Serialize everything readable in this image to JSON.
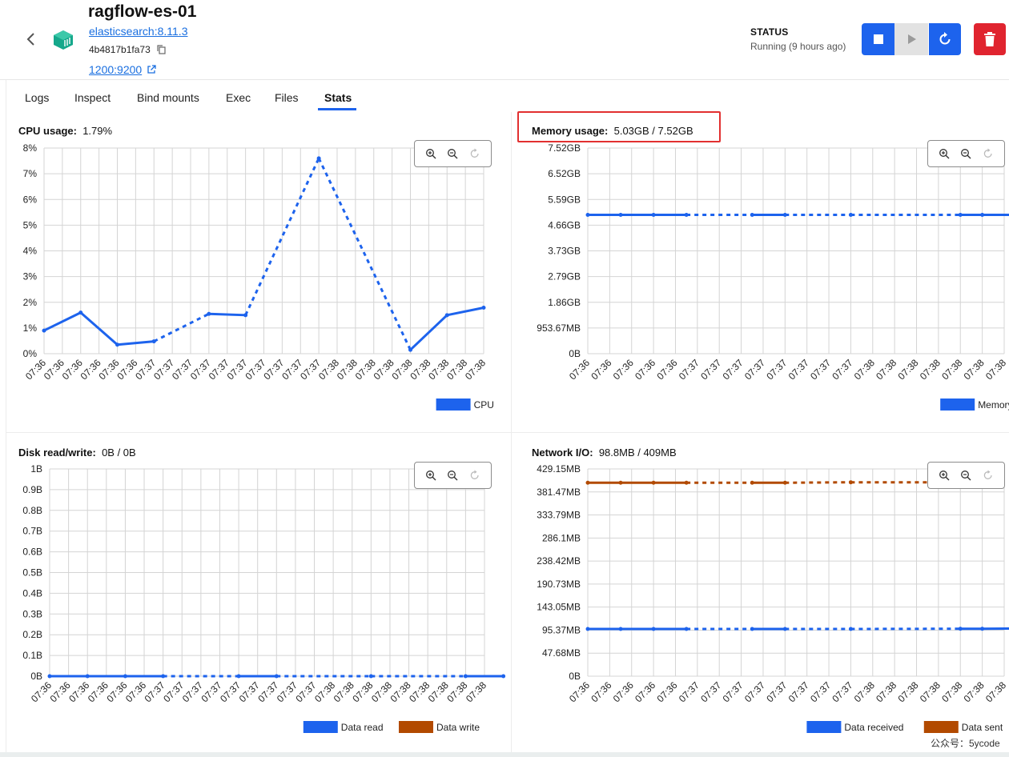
{
  "header": {
    "back_icon": "chevron-left-icon",
    "container_icon": "container-cube-icon",
    "name": "ragflow-es-01",
    "image": "elasticsearch:8.11.3",
    "container_id": "4b4817b1fa73",
    "port": "1200:9200",
    "status_label": "STATUS",
    "status_value": "Running (9 hours ago)",
    "accent_color": "#1d63ed",
    "danger_color": "#e0242f"
  },
  "tabs": [
    {
      "label": "Logs",
      "active": false
    },
    {
      "label": "Inspect",
      "active": false
    },
    {
      "label": "Bind mounts",
      "active": false
    },
    {
      "label": "Exec",
      "active": false
    },
    {
      "label": "Files",
      "active": false
    },
    {
      "label": "Stats",
      "active": true
    }
  ],
  "panels": {
    "cpu": {
      "title": "CPU usage:",
      "value": "1.79%"
    },
    "memory": {
      "title": "Memory usage:",
      "value": "5.03GB / 7.52GB"
    },
    "disk": {
      "title": "Disk read/write:",
      "value": "0B / 0B"
    },
    "network": {
      "title": "Network I/O:",
      "value": "98.8MB / 409MB"
    }
  },
  "watermark": "公众号：5ycode",
  "chart_data": [
    {
      "id": "cpu",
      "type": "line",
      "title": "CPU usage:",
      "x": [
        "07:36",
        "07:36",
        "07:36",
        "07:36",
        "07:36",
        "07:36",
        "07:37",
        "07:37",
        "07:37",
        "07:37",
        "07:37",
        "07:37",
        "07:37",
        "07:37",
        "07:37",
        "07:37",
        "07:38",
        "07:38",
        "07:38",
        "07:38",
        "07:38",
        "07:38",
        "07:38",
        "07:38",
        "07:38"
      ],
      "yticks": [
        "0%",
        "1%",
        "2%",
        "3%",
        "4%",
        "5%",
        "6%",
        "7%",
        "8%"
      ],
      "ylim": [
        0,
        8
      ],
      "grid": true,
      "legend_position": "bottom-right",
      "series": [
        {
          "name": "CPU",
          "color": "#1d63ed",
          "points": [
            [
              0,
              0.9
            ],
            [
              2,
              1.6
            ],
            [
              4,
              0.35
            ],
            [
              6,
              0.48
            ],
            [
              9,
              1.55
            ],
            [
              11,
              1.5
            ],
            [
              15,
              7.6
            ],
            [
              20,
              0.15
            ],
            [
              22,
              1.5
            ],
            [
              24,
              1.79
            ]
          ],
          "dashed_ranges": [
            [
              6,
              9
            ],
            [
              11,
              20
            ]
          ]
        }
      ]
    },
    {
      "id": "memory",
      "type": "line",
      "title": "Memory usage:",
      "x": [
        "07:36",
        "07:36",
        "07:36",
        "07:36",
        "07:36",
        "07:37",
        "07:37",
        "07:37",
        "07:37",
        "07:37",
        "07:37",
        "07:37",
        "07:37",
        "07:38",
        "07:38",
        "07:38",
        "07:38",
        "07:38",
        "07:38",
        "07:38"
      ],
      "yticks": [
        "0B",
        "953.67MB",
        "1.86GB",
        "2.79GB",
        "3.73GB",
        "4.66GB",
        "5.59GB",
        "6.52GB",
        "7.52GB"
      ],
      "ylim": [
        0,
        8
      ],
      "grid": true,
      "legend_position": "bottom-right",
      "series": [
        {
          "name": "Memory",
          "color": "#1d63ed",
          "points": [
            [
              0,
              5.4
            ],
            [
              1.5,
              5.4
            ],
            [
              3,
              5.4
            ],
            [
              4.5,
              5.4
            ],
            [
              7.5,
              5.4
            ],
            [
              9,
              5.4
            ],
            [
              12,
              5.4
            ],
            [
              17,
              5.4
            ],
            [
              18,
              5.4
            ],
            [
              19.5,
              5.4
            ]
          ],
          "dashed_ranges": [
            [
              4.5,
              7.5
            ],
            [
              9,
              17
            ]
          ]
        }
      ]
    },
    {
      "id": "disk",
      "type": "line",
      "title": "Disk read/write:",
      "x": [
        "07:36",
        "07:36",
        "07:36",
        "07:36",
        "07:36",
        "07:36",
        "07:37",
        "07:37",
        "07:37",
        "07:37",
        "07:37",
        "07:37",
        "07:37",
        "07:37",
        "07:37",
        "07:38",
        "07:38",
        "07:38",
        "07:38",
        "07:38",
        "07:38",
        "07:38",
        "07:38",
        "07:38"
      ],
      "yticks": [
        "0B",
        "0.1B",
        "0.2B",
        "0.3B",
        "0.4B",
        "0.5B",
        "0.6B",
        "0.7B",
        "0.8B",
        "0.9B",
        "1B"
      ],
      "ylim": [
        0,
        1
      ],
      "grid": true,
      "legend_position": "bottom-right",
      "series": [
        {
          "name": "Data read",
          "color": "#1d63ed",
          "points": [
            [
              0,
              0
            ],
            [
              2,
              0
            ],
            [
              4,
              0
            ],
            [
              6,
              0
            ],
            [
              10,
              0
            ],
            [
              12,
              0
            ],
            [
              17,
              0
            ],
            [
              22,
              0
            ],
            [
              24,
              0
            ]
          ],
          "dashed_ranges": [
            [
              6,
              10
            ],
            [
              12,
              22
            ]
          ]
        },
        {
          "name": "Data write",
          "color": "#b24a00",
          "points": [],
          "dashed_ranges": []
        }
      ]
    },
    {
      "id": "network",
      "type": "line",
      "title": "Network I/O:",
      "x": [
        "07:36",
        "07:36",
        "07:36",
        "07:36",
        "07:36",
        "07:37",
        "07:37",
        "07:37",
        "07:37",
        "07:37",
        "07:37",
        "07:37",
        "07:37",
        "07:38",
        "07:38",
        "07:38",
        "07:38",
        "07:38",
        "07:38",
        "07:38"
      ],
      "yticks": [
        "0B",
        "47.68MB",
        "95.37MB",
        "143.05MB",
        "190.73MB",
        "238.42MB",
        "286.1MB",
        "333.79MB",
        "381.47MB",
        "429.15MB"
      ],
      "ylim": [
        0,
        9
      ],
      "grid": true,
      "legend_position": "bottom-right",
      "series": [
        {
          "name": "Data received",
          "color": "#1d63ed",
          "points": [
            [
              0,
              2.05
            ],
            [
              1.5,
              2.05
            ],
            [
              3,
              2.05
            ],
            [
              4.5,
              2.05
            ],
            [
              7.5,
              2.05
            ],
            [
              9,
              2.05
            ],
            [
              12,
              2.05
            ],
            [
              17,
              2.06
            ],
            [
              18,
              2.06
            ],
            [
              19.5,
              2.07
            ]
          ],
          "dashed_ranges": [
            [
              4.5,
              7.5
            ],
            [
              9,
              17
            ]
          ]
        },
        {
          "name": "Data sent",
          "color": "#b24a00",
          "points": [
            [
              0,
              8.4
            ],
            [
              1.5,
              8.4
            ],
            [
              3,
              8.4
            ],
            [
              4.5,
              8.4
            ],
            [
              7.5,
              8.4
            ],
            [
              9,
              8.4
            ],
            [
              12,
              8.42
            ],
            [
              16.5,
              8.42
            ]
          ],
          "dashed_ranges": [
            [
              4.5,
              7.5
            ],
            [
              9,
              16.5
            ]
          ]
        }
      ]
    }
  ]
}
